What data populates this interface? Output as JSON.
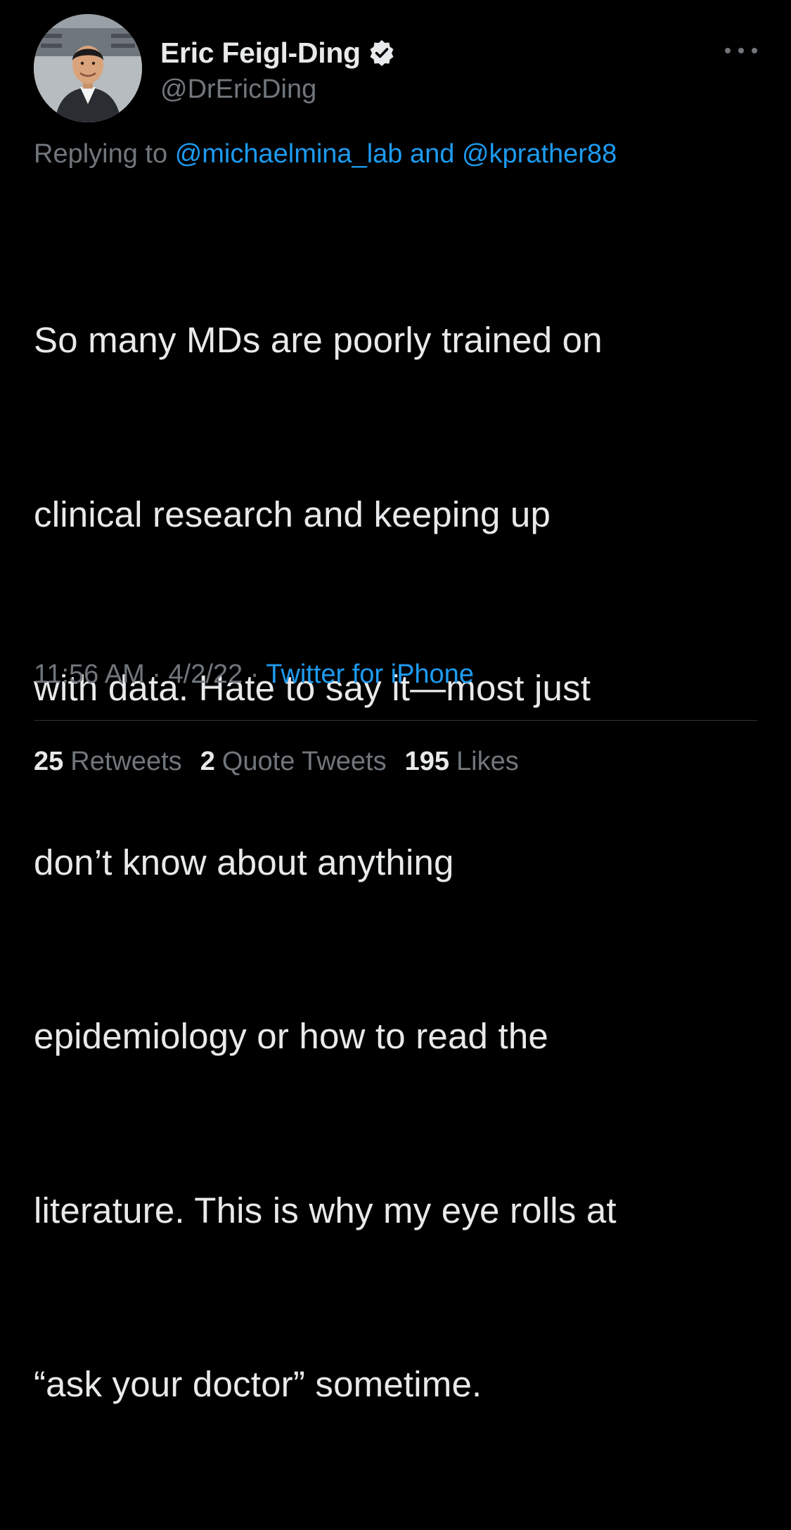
{
  "author": {
    "display_name": "Eric Feigl-Ding",
    "handle": "@DrEricDing",
    "avatar_icon": "profile-photo",
    "verified_icon": "verified-badge-icon"
  },
  "more_icon": "ellipsis-icon",
  "reply": {
    "prefix": "Replying to",
    "user1": "@michaelmina_lab",
    "conjunction": "and",
    "user2": "@kprather88"
  },
  "tweet": {
    "lines": [
      "So many MDs are poorly trained on",
      "clinical research and keeping up",
      "with data. Hate to say it—most just",
      "don’t know about anything",
      "epidemiology or how to read the",
      "literature. This is why my eye rolls at",
      "“ask your doctor” sometime."
    ]
  },
  "meta": {
    "time": "11:56 AM",
    "separator": "·",
    "date": "4/2/22",
    "source": "Twitter for iPhone"
  },
  "stats": {
    "retweets_count": "25",
    "retweets_label": "Retweets",
    "quotes_count": "2",
    "quotes_label": "Quote Tweets",
    "likes_count": "195",
    "likes_label": "Likes"
  },
  "colors": {
    "background": "#000000",
    "primary_text": "#e7e9ea",
    "secondary_text": "#71767b",
    "link": "#1d9bf0",
    "divider": "#2f3336"
  }
}
